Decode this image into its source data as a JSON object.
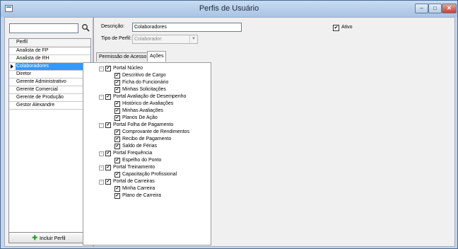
{
  "window": {
    "title": "Perfis de Usuário",
    "minimize": "–",
    "maximize": "□",
    "close": "✕"
  },
  "left": {
    "search": {
      "value": "",
      "placeholder": ""
    },
    "list_header": "Perfil",
    "items": [
      {
        "label": "Analista de FP",
        "selected": false
      },
      {
        "label": "Analista de RH",
        "selected": false
      },
      {
        "label": "Colaboradores",
        "selected": true
      },
      {
        "label": "Diretor",
        "selected": false
      },
      {
        "label": "Gerente Administrativo",
        "selected": false
      },
      {
        "label": "Gerente Comercial",
        "selected": false
      },
      {
        "label": "Gerente de Produção",
        "selected": false
      },
      {
        "label": "Gestor Alexandre",
        "selected": false
      }
    ],
    "add_button": "Incluir Perfil"
  },
  "form": {
    "descricao_label": "Descrição:",
    "descricao_value": "Colaboradores",
    "tipo_label": "Tipo de Perfil:",
    "tipo_value": "Colaborador",
    "ativo_label": "Ativo",
    "ativo_checked": true
  },
  "tabs": [
    {
      "label": "Permissão de Acesso",
      "active": false
    },
    {
      "label": "Ações",
      "active": true
    }
  ],
  "tree": [
    {
      "label": "Portal Núcleo",
      "checked": true,
      "children": [
        {
          "label": "Descritivo de Cargo",
          "checked": true
        },
        {
          "label": "Ficha do Funcionário",
          "checked": true
        },
        {
          "label": "Minhas Solicitações",
          "checked": true
        }
      ]
    },
    {
      "label": "Portal Avaliação de Desempenho",
      "checked": true,
      "children": [
        {
          "label": "Histórico de Avaliações",
          "checked": true
        },
        {
          "label": "Minhas Avaliações",
          "checked": true
        },
        {
          "label": "Planos De Ação",
          "checked": true
        }
      ]
    },
    {
      "label": "Portal Folha de Pagamento",
      "checked": true,
      "children": [
        {
          "label": "Comprovante de Rendimentos",
          "checked": true
        },
        {
          "label": "Recibo de Pagamento",
          "checked": true
        },
        {
          "label": "Saldo de Férias",
          "checked": true
        }
      ]
    },
    {
      "label": "Portal Frequência",
      "checked": true,
      "children": [
        {
          "label": "Espelho do Ponto",
          "checked": true
        }
      ]
    },
    {
      "label": "Portal Treinamento",
      "checked": true,
      "children": [
        {
          "label": "Capacitação Profissional",
          "checked": true
        }
      ]
    },
    {
      "label": "Portal de Carreiras",
      "checked": true,
      "children": [
        {
          "label": "Minha Carreira",
          "checked": true
        },
        {
          "label": "Plano de Carreira",
          "checked": true
        }
      ]
    }
  ]
}
